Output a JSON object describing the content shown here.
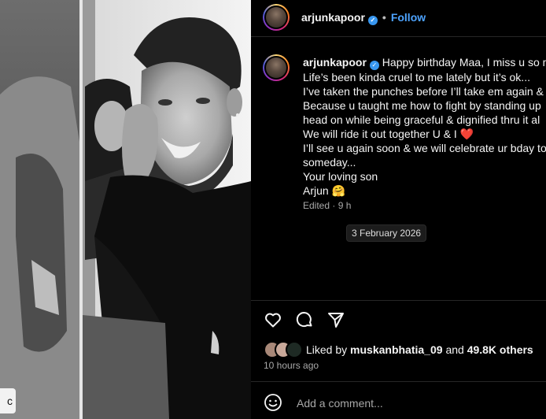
{
  "photo": {
    "label_fragment": "c"
  },
  "header": {
    "username": "arjunkapoor",
    "separator": "•",
    "follow_label": "Follow"
  },
  "caption": {
    "username": "arjunkapoor",
    "lines": [
      "Happy birthday Maa, I miss u so m",
      "Life’s been kinda cruel to me lately but it’s ok...",
      "I’ve taken the punches before I’ll take em again &",
      "Because u taught me how to fight by standing up",
      "head on while being graceful & dignified thru it al",
      "We will ride it out together U & I",
      "I’ll see u again soon & we will celebrate ur bday to",
      "someday...",
      "Your loving son",
      "Arjun"
    ],
    "heart_emoji": "❤️",
    "hug_emoji": "🤗",
    "edited_label": "Edited",
    "edited_dot": "·",
    "edited_time": "9 h"
  },
  "date_chip": "3 February 2026",
  "actions": {
    "like_icon": "heart-outline-icon",
    "comment_icon": "comment-bubble-icon",
    "share_icon": "paper-plane-icon"
  },
  "likes": {
    "prefix": "Liked by",
    "user": "muskanbhatia_09",
    "middle": "and",
    "count": "49.8K others"
  },
  "time_ago": "10 hours ago",
  "comment": {
    "placeholder": "Add a comment...",
    "emoji_icon": "smiley-icon"
  },
  "colors": {
    "background": "#000000",
    "link_blue": "#4da3ff",
    "verified_blue": "#3897f0",
    "muted_text": "#a8a8a8"
  }
}
